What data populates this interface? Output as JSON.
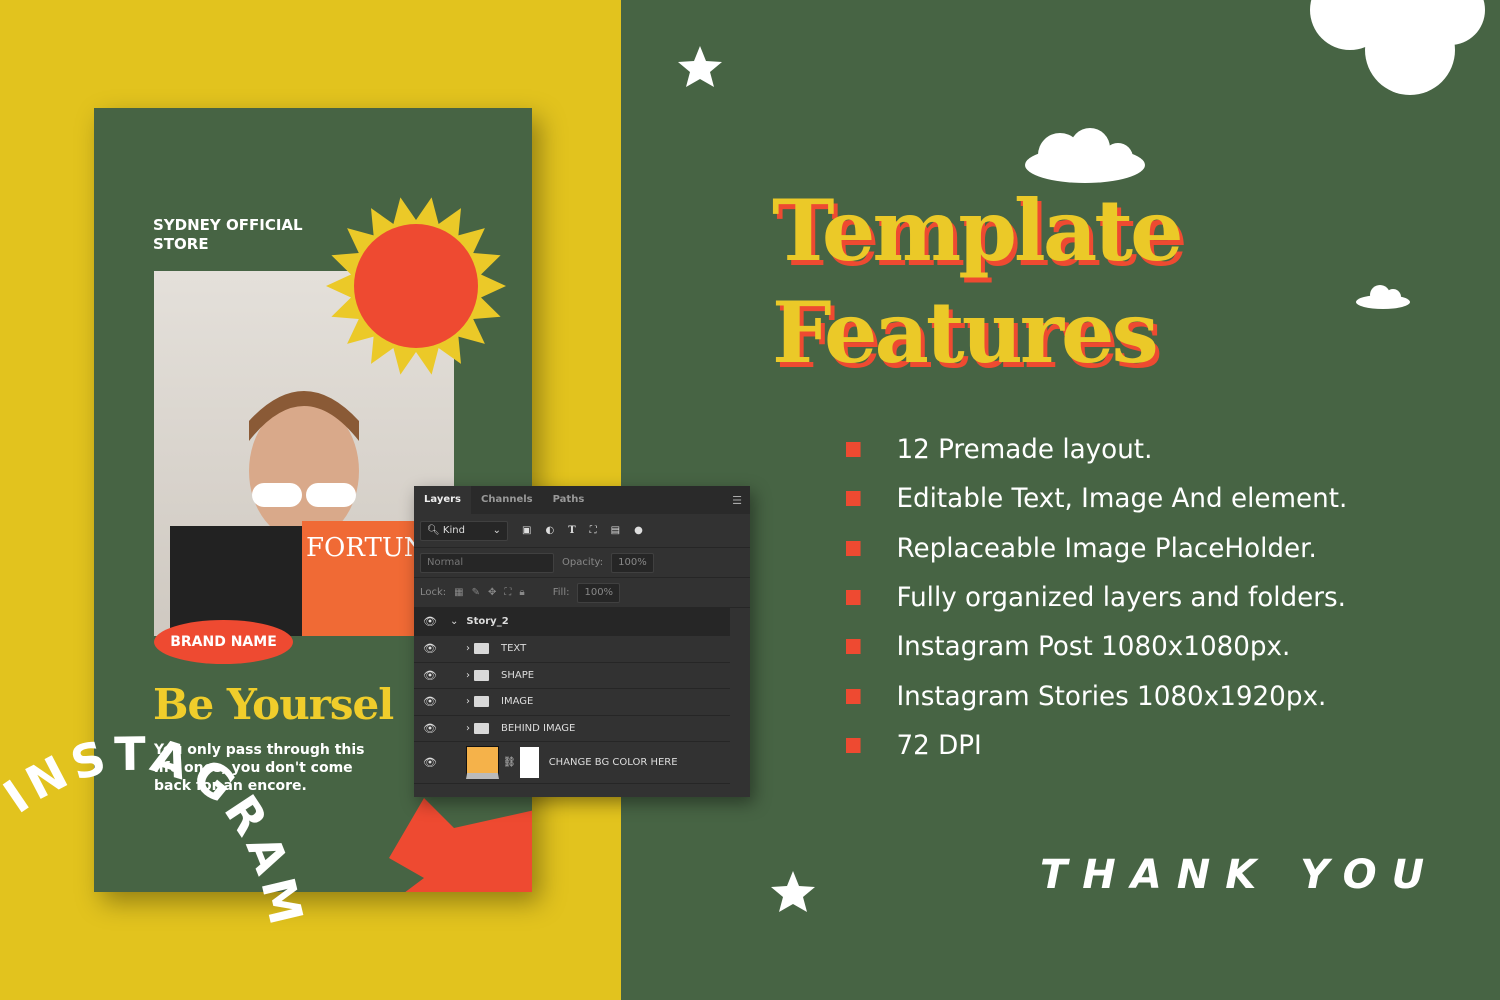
{
  "colors": {
    "yellow": "#e2c31e",
    "green": "#476444",
    "red": "#ee4a31",
    "title_yellow": "#ebc928"
  },
  "card": {
    "store": "SYDNEY OFFICIAL STORE",
    "brand": "BRAND NAME",
    "headline": "Be Yoursel",
    "description": "You only pass through this life once, you don't come back for an encore.",
    "curved_text": "INSTAGRAM"
  },
  "layers_panel": {
    "tabs": [
      "Layers",
      "Channels",
      "Paths"
    ],
    "filter": "Kind",
    "blend_mode": "Normal",
    "opacity_label": "Opacity:",
    "opacity": "100%",
    "lock_label": "Lock:",
    "fill_label": "Fill:",
    "fill": "100%",
    "group": "Story_2",
    "layers": [
      "TEXT",
      "SHAPE",
      "IMAGE",
      "BEHIND IMAGE"
    ],
    "bg_layer": "CHANGE BG COLOR HERE",
    "bg_swatch": "#f5b24a"
  },
  "title": {
    "line1": "Template",
    "line2": "Features"
  },
  "features": [
    "12 Premade layout.",
    "Editable Text, Image And element.",
    "Replaceable Image PlaceHolder.",
    "Fully organized layers and folders.",
    "Instagram Post 1080x1080px.",
    "Instagram Stories 1080x1920px.",
    "72 DPI"
  ],
  "footer": "THANK YOU"
}
